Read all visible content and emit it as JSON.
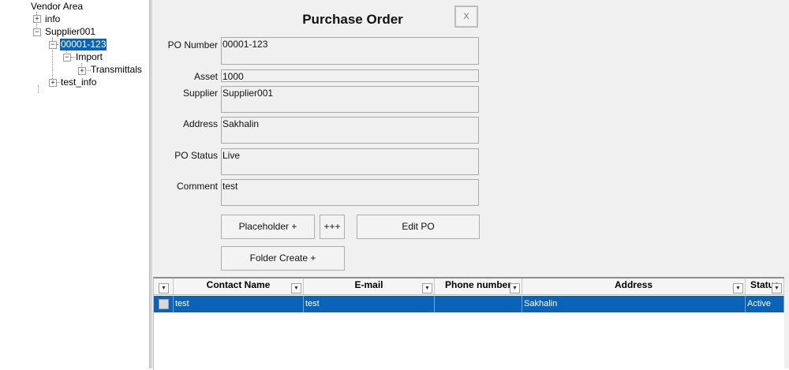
{
  "tree": {
    "root": "Vendor Area",
    "nodes": [
      {
        "label": "info",
        "toggle": "+"
      },
      {
        "label": "Supplier001",
        "toggle": "−"
      },
      {
        "label": "00001-123",
        "toggle": "−"
      },
      {
        "label": "Import",
        "toggle": "−"
      },
      {
        "label": "Transmittals",
        "toggle": "+"
      },
      {
        "label": "test_info",
        "toggle": "+"
      }
    ]
  },
  "form": {
    "title": "Purchase Order",
    "close_label": "X",
    "fields": [
      {
        "label": "PO Number",
        "value": "00001-123"
      },
      {
        "label": "Asset",
        "value": "1000"
      },
      {
        "label": "Supplier",
        "value": "Supplier001"
      },
      {
        "label": "Address",
        "value": "Sakhalin"
      },
      {
        "label": "PO Status",
        "value": "Live"
      },
      {
        "label": "Comment",
        "value": "test"
      }
    ],
    "buttons": {
      "placeholder": "Placeholder +",
      "plus3": "+++",
      "edit_po": "Edit PO",
      "folder_create": "Folder Create +"
    }
  },
  "grid": {
    "columns": [
      "Contact Name",
      "E-mail",
      "Phone number",
      "Address",
      "Status"
    ],
    "rows": [
      {
        "contact_name": "test",
        "email": "test",
        "phone": "",
        "address": "Sakhalin",
        "status": "Active"
      }
    ],
    "dropdown_glyph": "▼"
  }
}
